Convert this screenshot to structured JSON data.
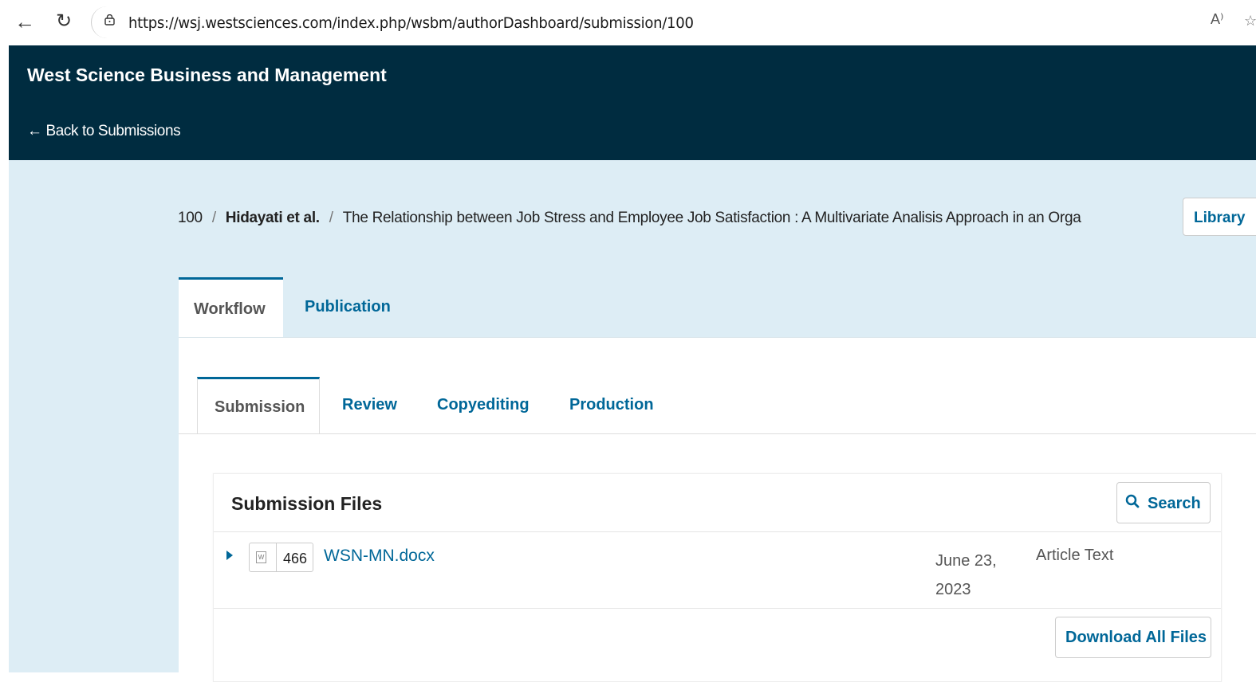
{
  "browser": {
    "url": "https://wsj.westsciences.com/index.php/wsbm/authorDashboard/submission/100",
    "read_aloud": "A⁾",
    "star": "☆"
  },
  "header": {
    "journal_title": "West Science Business and Management",
    "back_link": "← Back to Submissions"
  },
  "breadcrumb": {
    "id": "100",
    "separator": "/",
    "author": "Hidayati et al.",
    "title": "The Relationship between Job Stress and Employee Job Satisfaction : A Multivariate Analisis Approach in an Orga"
  },
  "library_button": "Library",
  "main_tabs": [
    {
      "label": "Workflow",
      "active": true
    },
    {
      "label": "Publication",
      "active": false
    }
  ],
  "stage_tabs": [
    {
      "label": "Submission",
      "active": true
    },
    {
      "label": "Review",
      "active": false
    },
    {
      "label": "Copyediting",
      "active": false
    },
    {
      "label": "Production",
      "active": false
    }
  ],
  "submission_files": {
    "title": "Submission Files",
    "search_label": "Search",
    "files": [
      {
        "id": "466",
        "name": "WSN-MN.docx",
        "date": "June 23, 2023",
        "type": "Article Text"
      }
    ],
    "download_all_label": "Download All Files"
  },
  "colors": {
    "header_bg": "#002c40",
    "accent": "#006798",
    "main_bg": "#ddedf5"
  }
}
